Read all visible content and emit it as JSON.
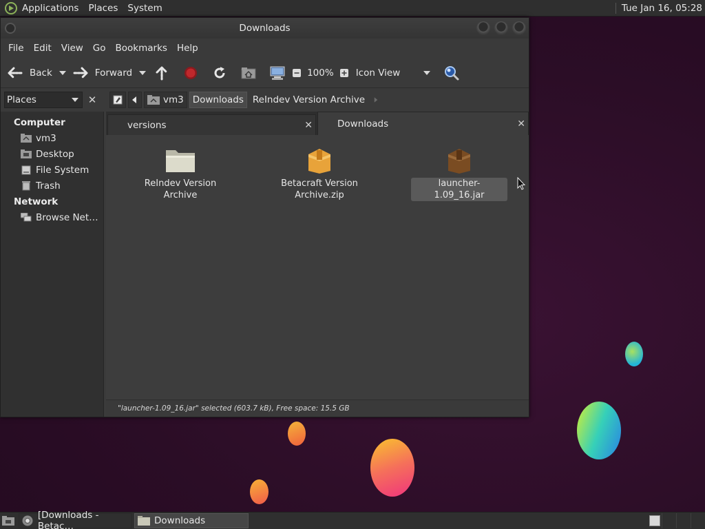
{
  "top_panel": {
    "menus": [
      "Applications",
      "Places",
      "System"
    ],
    "clock": "Tue Jan 16, 05:28"
  },
  "window": {
    "title": "Downloads",
    "menu": [
      "File",
      "Edit",
      "View",
      "Go",
      "Bookmarks",
      "Help"
    ],
    "toolbar": {
      "back_label": "Back",
      "forward_label": "Forward",
      "zoom_level": "100%",
      "view_mode": "Icon View"
    },
    "location": {
      "pane_label": "Places",
      "crumbs": [
        "vm3",
        "Downloads",
        "ReIndev Version Archive"
      ],
      "active_crumb": "Downloads"
    },
    "sidebar": {
      "sections": [
        {
          "heading": "Computer",
          "items": [
            {
              "label": "vm3",
              "icon": "home-folder-icon"
            },
            {
              "label": "Desktop",
              "icon": "desktop-icon"
            },
            {
              "label": "File System",
              "icon": "drive-icon"
            },
            {
              "label": "Trash",
              "icon": "trash-icon"
            }
          ]
        },
        {
          "heading": "Network",
          "items": [
            {
              "label": "Browse Net…",
              "icon": "network-icon"
            }
          ]
        }
      ]
    },
    "tabs": [
      {
        "label": "versions",
        "active": false
      },
      {
        "label": "Downloads",
        "active": true
      }
    ],
    "files": [
      {
        "name_line1": "ReIndev Version",
        "name_line2": "Archive",
        "type": "folder",
        "selected": false
      },
      {
        "name_line1": "Betacraft Version",
        "name_line2": "Archive.zip",
        "type": "zip-archive",
        "selected": false
      },
      {
        "name_line1": "launcher-1.09_16.jar",
        "name_line2": "",
        "type": "jar-archive",
        "selected": true
      }
    ],
    "status": "\"launcher-1.09_16.jar\" selected (603.7 kB), Free space: 15.5 GB"
  },
  "taskbar": {
    "tasks": [
      {
        "label": "[Downloads - Betac…",
        "icon": "chrome-icon",
        "active": false
      },
      {
        "label": "Downloads",
        "icon": "folder-icon",
        "active": true
      }
    ]
  },
  "colors": {
    "panel_bg": "#2f2f2f",
    "window_bg": "#3b3b3b",
    "desktop_bg": "#2b0d26",
    "folder_color": "#d6d5c4",
    "zip_color": "#e8a33a",
    "jar_color": "#8a5a2a",
    "stop_red": "#c0282c",
    "search_blue": "#3a7bd5"
  }
}
